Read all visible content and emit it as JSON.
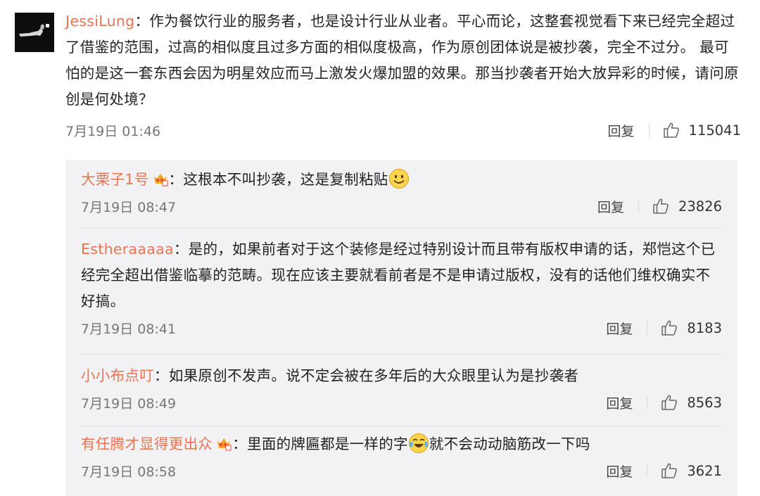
{
  "main": {
    "user": "JessiLung",
    "colon": "：",
    "text": "作为餐饮行业的服务者，也是设计行业从业者。平心而论，这整套视觉看下来已经完全超过了借鉴的范围，过高的相似度且过多方面的相似度极高，作为原创团体说是被抄袭，完全不过分。 最可怕的是这一套东西会因为明星效应而马上激发火爆加盟的效果。那当抄袭者开始大放异彩的时候，请问原创是何处境？",
    "time": "7月19日 01:46",
    "reply_label": "回复",
    "likes": "115041"
  },
  "replies": [
    {
      "user": "大栗子1号",
      "colon": "：",
      "text": "这根本不叫抄袭，这是复制粘贴",
      "time": "7月19日 08:47",
      "reply_label": "回复",
      "likes": "23826"
    },
    {
      "user": "Estheraaaaa",
      "colon": "：",
      "text": "是的，如果前者对于这个装修是经过特别设计而且带有版权申请的话，郑恺这个已经完全超出借鉴临摹的范畴。现在应该主要就看前者是不是申请过版权，没有的话他们维权确实不好搞。",
      "time": "7月19日 08:41",
      "reply_label": "回复",
      "likes": "8183"
    },
    {
      "user": "小小布点叮",
      "colon": "：",
      "text": "如果原创不发声。说不定会被在多年后的大众眼里认为是抄袭者",
      "time": "7月19日 08:49",
      "reply_label": "回复",
      "likes": "8563"
    },
    {
      "user": "有任腾才显得更出众",
      "colon": "：",
      "text_before": "里面的牌匾都是一样的字",
      "text_after": "就不会动动脑筋改一下吗",
      "time": "7月19日 08:58",
      "reply_label": "回复",
      "likes": "3621"
    }
  ],
  "icons": {
    "like": "thumbs-up-icon",
    "vip": "vip-crown-icon",
    "smile": "smile-emoji",
    "laugh_cry": "laugh-cry-emoji"
  },
  "colors": {
    "username": "#eb7350",
    "reply_bg": "#f2f2f5"
  }
}
